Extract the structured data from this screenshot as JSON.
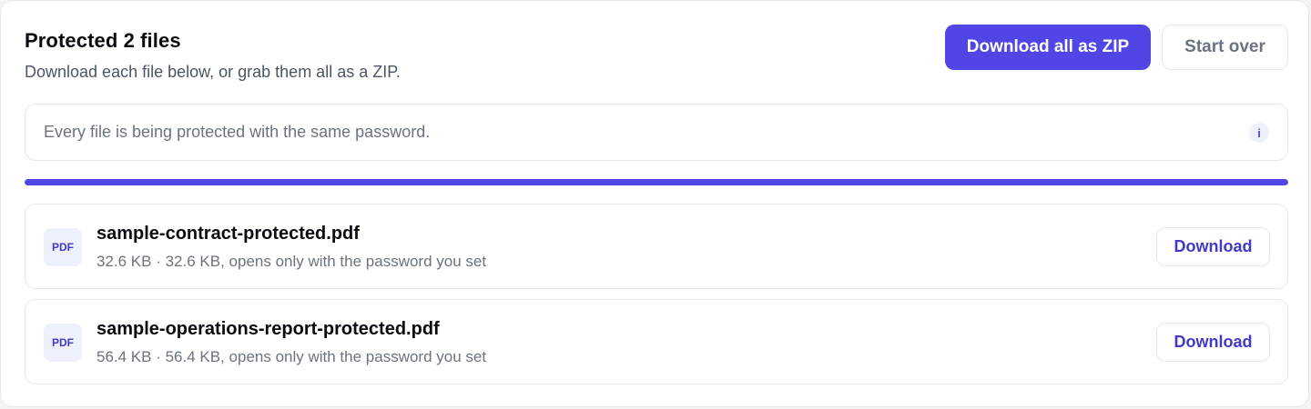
{
  "header": {
    "title": "Protected 2 files",
    "subtitle": "Download each file below, or grab them all as a ZIP."
  },
  "actions": {
    "download_zip_label": "Download all as ZIP",
    "start_over_label": "Start over"
  },
  "notice": {
    "text": "Every file is being protected with the same password.",
    "icon": "info-icon",
    "icon_glyph": "i"
  },
  "progress": {
    "percent": 100
  },
  "files": [
    {
      "badge": "PDF",
      "name": "sample-contract-protected.pdf",
      "meta": "32.6 KB · 32.6 KB, opens only with the password you set",
      "download_label": "Download"
    },
    {
      "badge": "PDF",
      "name": "sample-operations-report-protected.pdf",
      "meta": "56.4 KB · 56.4 KB, opens only with the password you set",
      "download_label": "Download"
    }
  ],
  "colors": {
    "accent": "#4f46e5",
    "accent_text": "#4338ca",
    "badge_bg": "#eef0fb",
    "border": "#e5e7eb",
    "muted_text": "#6b7280"
  }
}
